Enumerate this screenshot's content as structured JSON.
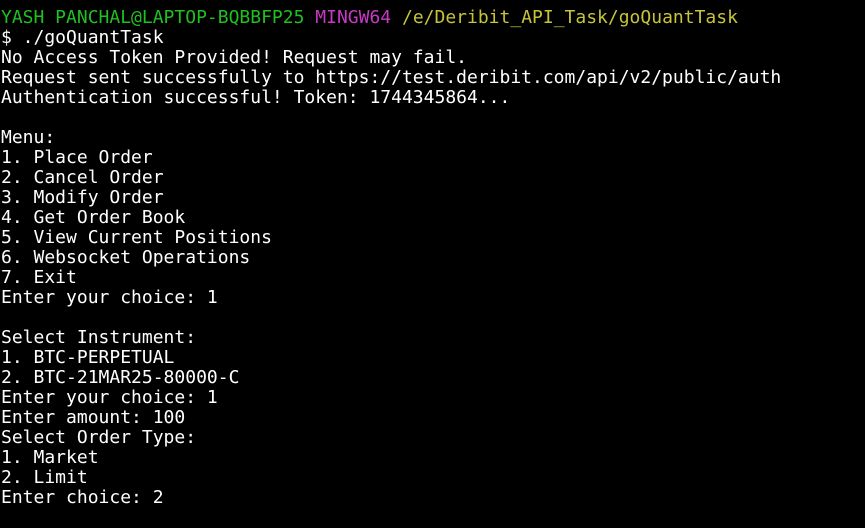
{
  "prompt": {
    "user_host": "YASH PANCHAL@LAPTOP-BQBBFP25",
    "shell": "MINGW64",
    "cwd": "/e/Deribit_API_Task/goQuantTask",
    "command": "$ ./goQuantTask"
  },
  "colors": {
    "background": "#000000",
    "foreground": "#ffffff",
    "user_host": "#1dc121",
    "shell": "#c839c5",
    "cwd": "#c7c43a"
  },
  "output": {
    "auth": [
      "No Access Token Provided! Request may fail.",
      "Request sent successfully to https://test.deribit.com/api/v2/public/auth",
      "Authentication successful! Token: 1744345864..."
    ],
    "menu": {
      "title": "Menu:",
      "items": [
        "1. Place Order",
        "2. Cancel Order",
        "3. Modify Order",
        "4. Get Order Book",
        "5. View Current Positions",
        "6. Websocket Operations",
        "7. Exit"
      ],
      "choice_prompt": "Enter your choice: 1"
    },
    "instrument": {
      "title": "Select Instrument:",
      "items": [
        "1. BTC-PERPETUAL",
        "2. BTC-21MAR25-80000-C"
      ],
      "choice_prompt": "Enter your choice: 1",
      "amount_prompt": "Enter amount: 100"
    },
    "order_type": {
      "title": "Select Order Type:",
      "items": [
        "1. Market",
        "2. Limit"
      ],
      "choice_prompt": "Enter choice: 2"
    }
  }
}
